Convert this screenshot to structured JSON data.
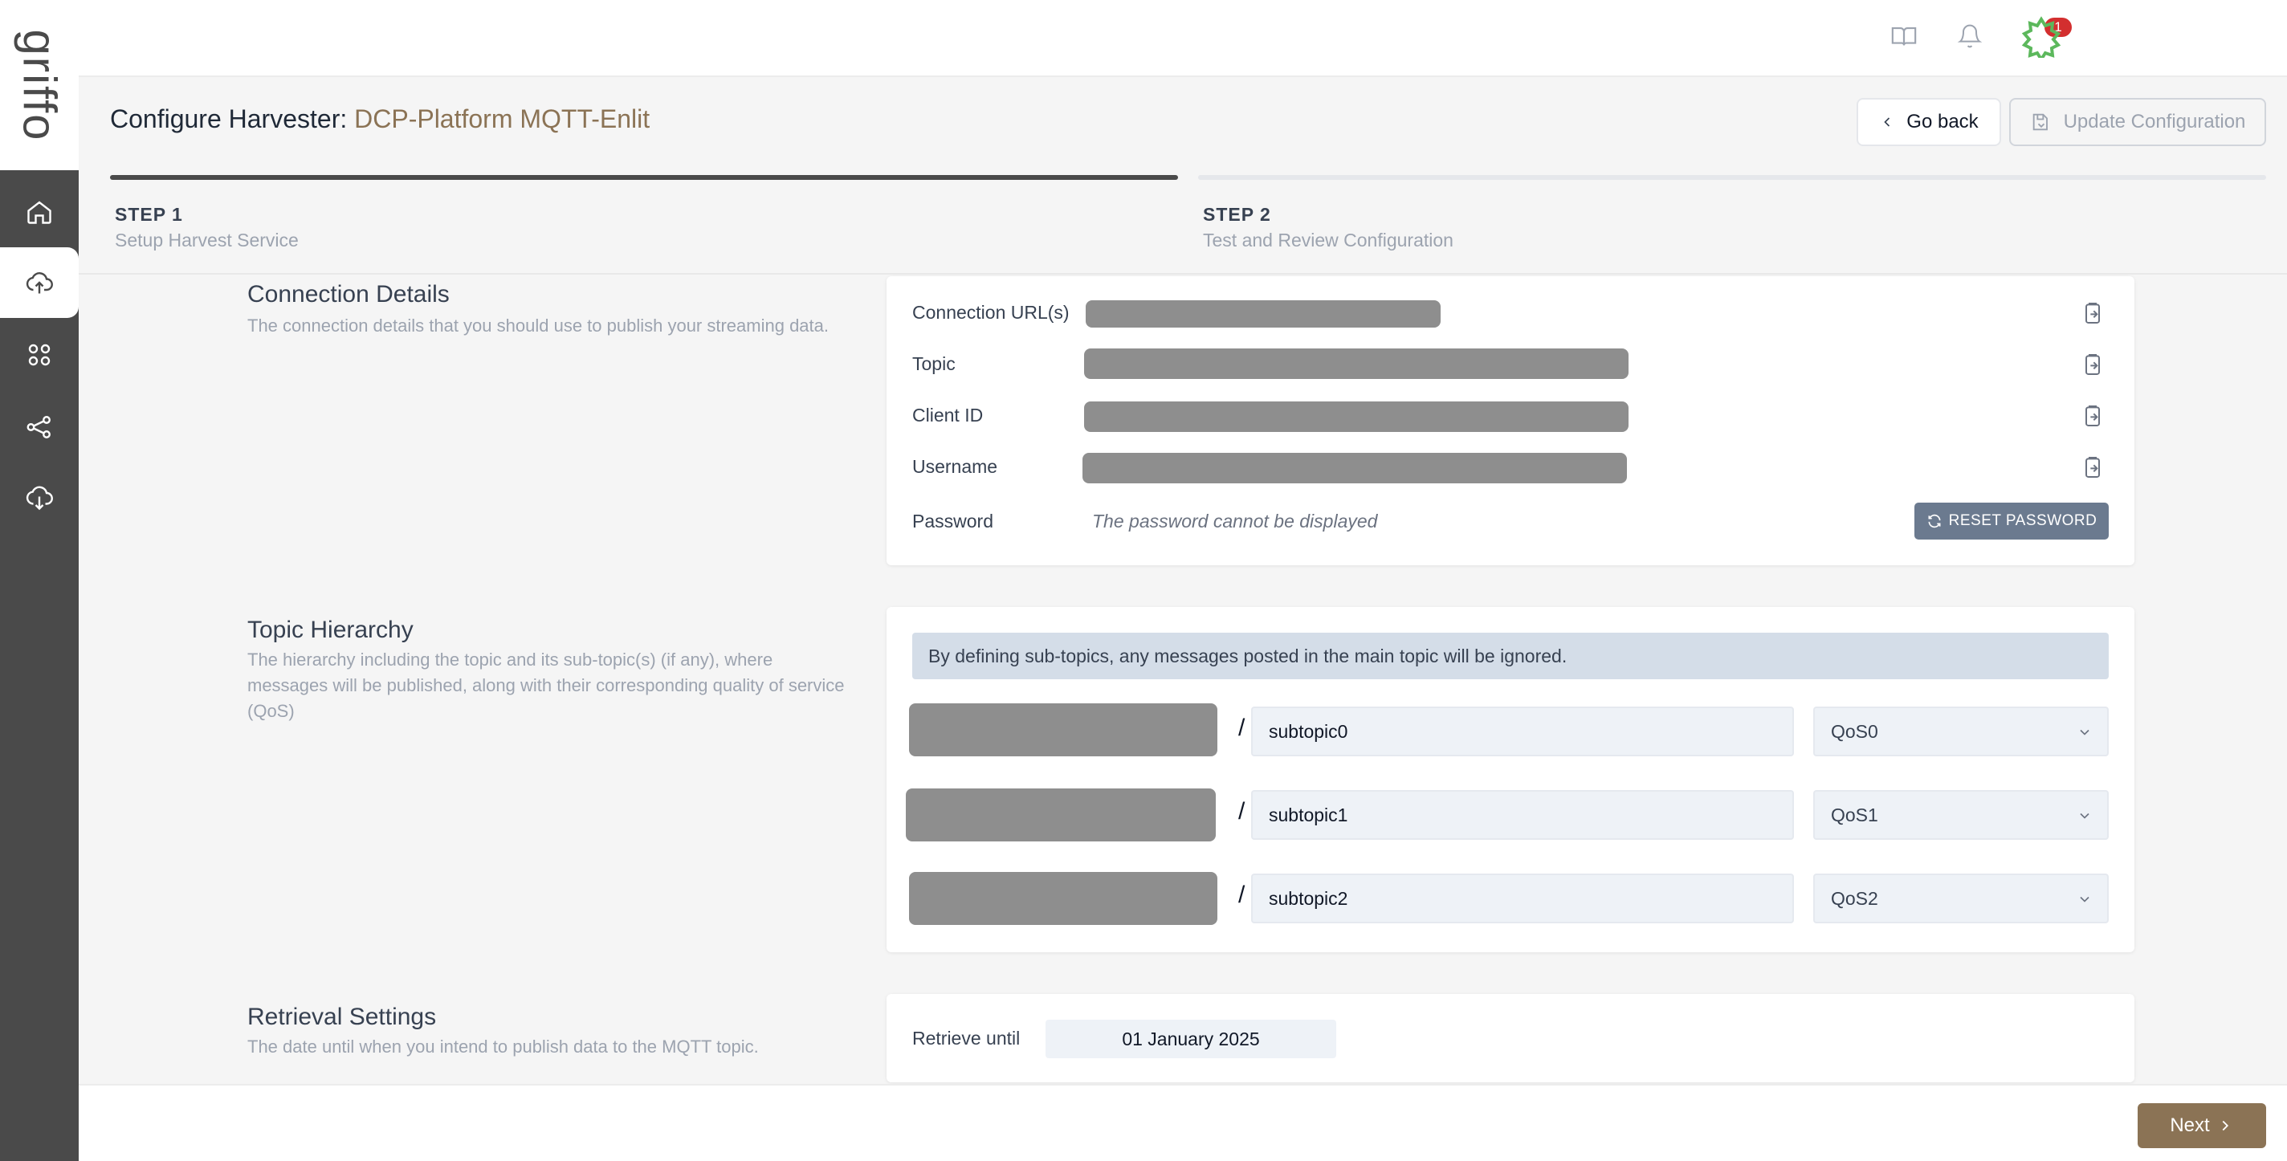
{
  "brand": {
    "logo_text": "griffo"
  },
  "topbar": {
    "notification_count": "1"
  },
  "header": {
    "title_prefix": "Configure Harvester: ",
    "title_name": "DCP-Platform MQTT-Enlit",
    "back_label": "Go back",
    "update_label": "Update Configuration"
  },
  "steps": [
    {
      "title": "STEP 1",
      "subtitle": "Setup Harvest Service"
    },
    {
      "title": "STEP 2",
      "subtitle": "Test and Review Configuration"
    }
  ],
  "connection": {
    "title": "Connection Details",
    "description": "The connection details that you should use to publish your streaming data.",
    "url_label": "Connection URL(s)",
    "topic_label": "Topic",
    "client_label": "Client ID",
    "username_label": "Username",
    "password_label": "Password",
    "password_message": "The password cannot be displayed",
    "reset_label": "RESET PASSWORD"
  },
  "hierarchy": {
    "title": "Topic Hierarchy",
    "description": "The hierarchy including the topic and its sub-topic(s) (if any), where messages will be published, along with their corresponding quality of service (QoS)",
    "banner": "By defining sub-topics, any messages posted in the main topic will be ignored.",
    "separator": "/",
    "rows": [
      {
        "subtopic": "subtopic0",
        "qos": "QoS0"
      },
      {
        "subtopic": "subtopic1",
        "qos": "QoS1"
      },
      {
        "subtopic": "subtopic2",
        "qos": "QoS2"
      }
    ]
  },
  "retrieval": {
    "title": "Retrieval Settings",
    "description": "The date until when you intend to publish data to the MQTT topic.",
    "label": "Retrieve until",
    "date": "01 January 2025"
  },
  "footer": {
    "next_label": "Next"
  },
  "colors": {
    "accent": "#8b7355",
    "sidebar": "#4a4a4a",
    "badge": "#d32f2f"
  }
}
